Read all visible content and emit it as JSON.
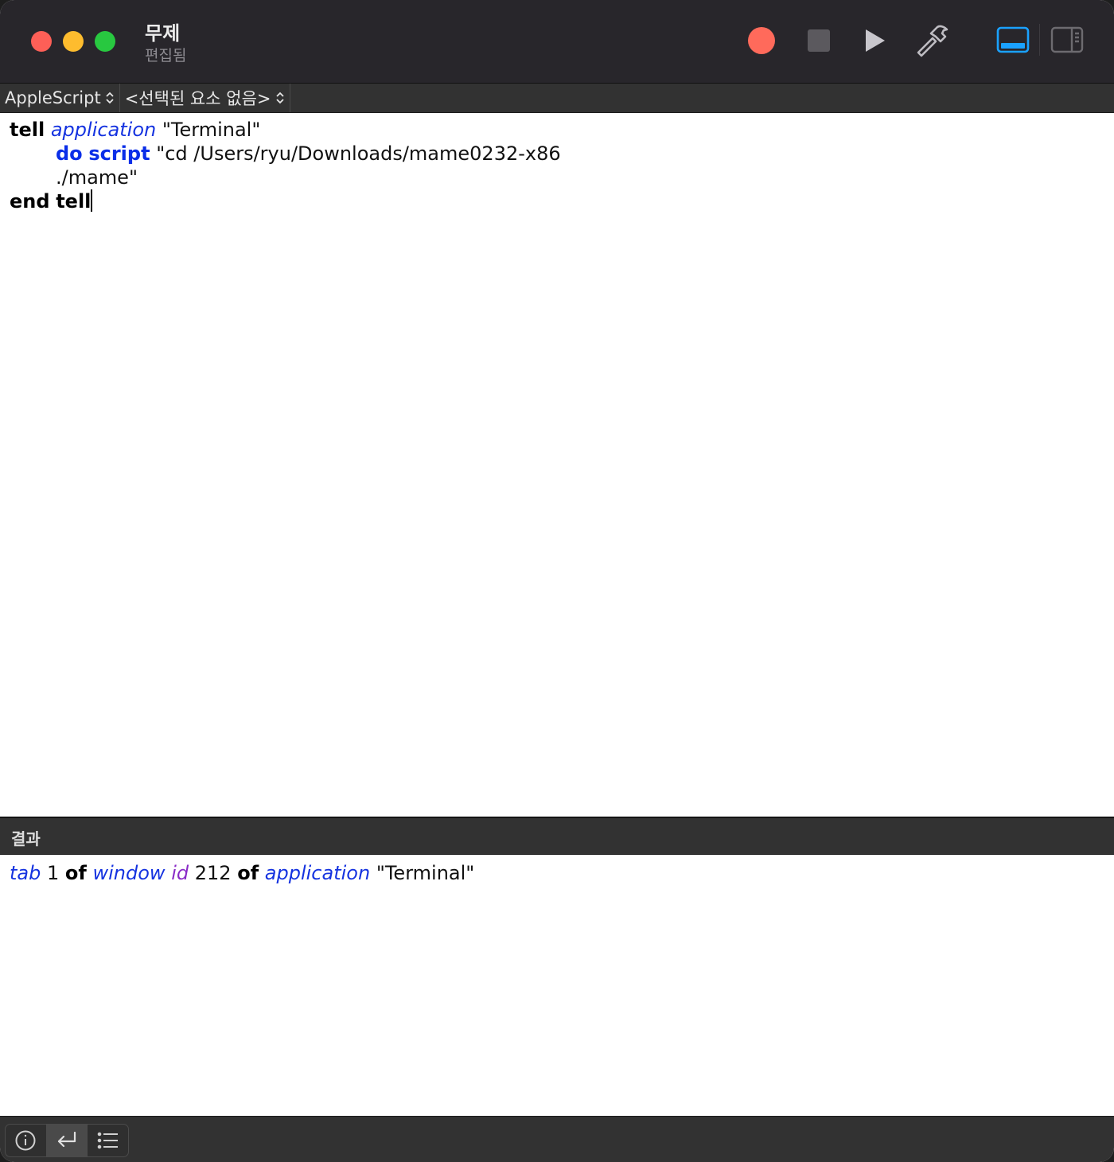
{
  "window": {
    "title": "무제",
    "subtitle": "편집됨"
  },
  "toolbar": {
    "record_icon": "record-icon",
    "stop_icon": "stop-icon",
    "run_icon": "play-icon",
    "compile_icon": "hammer-icon",
    "view_bottom_icon": "bottom-panel-icon",
    "view_side_icon": "sidebar-icon",
    "accent_color": "#1aa1ff",
    "record_color": "#ff6a5b"
  },
  "navbar": {
    "language": "AppleScript",
    "element": "<선택된 요소 없음>"
  },
  "script": {
    "line1": {
      "kw1": "tell",
      "cls": "application",
      "str": "\"Terminal\""
    },
    "line2": {
      "kw1": "do",
      "kw2": "script",
      "str": "\"cd /Users/ryu/Downloads/mame0232-x86"
    },
    "line3": {
      "str": "./mame\""
    },
    "line4": {
      "kw1": "end",
      "kw2": "tell"
    }
  },
  "result": {
    "header": "결과",
    "value": {
      "c1": "tab",
      "n1": "1",
      "k1": "of",
      "c2": "window",
      "p1": "id",
      "n2": "212",
      "k2": "of",
      "c3": "application",
      "s1": "\"Terminal\""
    }
  },
  "bottombar": {
    "buttons": [
      "info-icon",
      "return-arrow-icon",
      "list-icon"
    ],
    "active_index": 1
  }
}
